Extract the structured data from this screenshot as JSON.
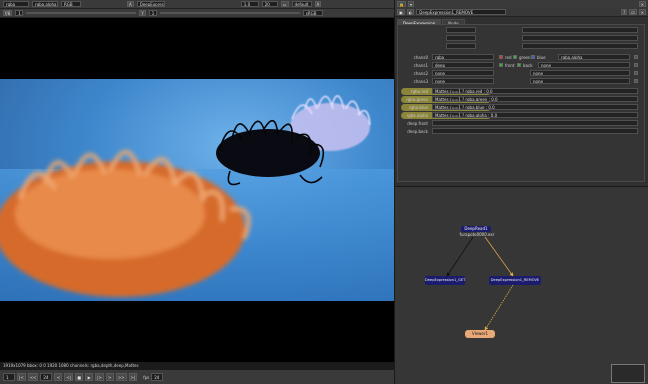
{
  "viewer": {
    "toolbar1": {
      "channels": "rgba",
      "channel_sub": "rgba.alpha",
      "display_mode": "RGB",
      "input_a": "DeepExpres",
      "zoom": "1.0",
      "scale": "20",
      "lut": "default",
      "cursor": "A"
    },
    "toolbar2": {
      "fstop": "f/8",
      "gain": "1",
      "gamma_label": "Y",
      "gamma": "1",
      "colorspace": "sRGB"
    },
    "status": "1919x1079 bbox: 0 0 1920 1080 channels: rgba,depth,deep,Mattes",
    "transport": {
      "frame_start": "1",
      "frame_current": "24",
      "fps_label": "fps",
      "fps": "24",
      "buttons": [
        "|<",
        "<<",
        "<",
        "<|",
        "■",
        "▶",
        "|>",
        ">",
        ">>",
        ">|"
      ]
    }
  },
  "properties": {
    "node_name": "DeepExpression1_REMOVE",
    "tabs": [
      "DeepExpression",
      "Node"
    ],
    "channel_rows": [
      {
        "label": "chans0",
        "value": "rgba",
        "checks": [
          {
            "label": "red",
            "color": "#d23a3a"
          },
          {
            "label": "green",
            "color": "#3ab43a"
          },
          {
            "label": "blue",
            "color": "#3a5ad2"
          }
        ],
        "extra": "rgba.alpha"
      },
      {
        "label": "chans1",
        "value": "deep",
        "checks": [
          {
            "label": "front",
            "color": "#3ab43a"
          },
          {
            "label": "back",
            "color": "#3ab43a"
          }
        ],
        "extra": "none"
      },
      {
        "label": "chans2",
        "value": "none",
        "checks": [],
        "extra": "none"
      },
      {
        "label": "chans3",
        "value": "none",
        "checks": [],
        "extra": "none"
      }
    ],
    "expr_rows": [
      {
        "label": "rgba.red",
        "expr": "Mattes.r==1 ? rgba.red : 0.0",
        "highlight": true
      },
      {
        "label": "rgba.green",
        "expr": "Mattes.r==1 ? rgba.green : 0.0",
        "highlight": true
      },
      {
        "label": "rgba.blue",
        "expr": "Mattes.r==1 ? rgba.blue : 0.0",
        "highlight": true
      },
      {
        "label": "rgba.alpha",
        "expr": "Mattes.r==1 ? rgba.alpha : 0.0",
        "highlight": true
      },
      {
        "label": "deep.front",
        "expr": "",
        "highlight": false
      },
      {
        "label": "deep.back",
        "expr": "",
        "highlight": false
      }
    ],
    "highlight_color": "#d2c83c"
  },
  "graph": {
    "nodes": {
      "deepread": {
        "line1": "DeepRead1",
        "line2": "furapoto0000.exr",
        "color": "#1c1c6e"
      },
      "get": {
        "label": "DeepExpression1_GET",
        "color": "#1c1c6e"
      },
      "remove": {
        "label": "DeepExpression1_REMOVE",
        "color": "#1c1c6e"
      },
      "viewer": {
        "label": "Viewer1",
        "color": "#e8a878"
      }
    },
    "connection_color": "#d8a648"
  }
}
